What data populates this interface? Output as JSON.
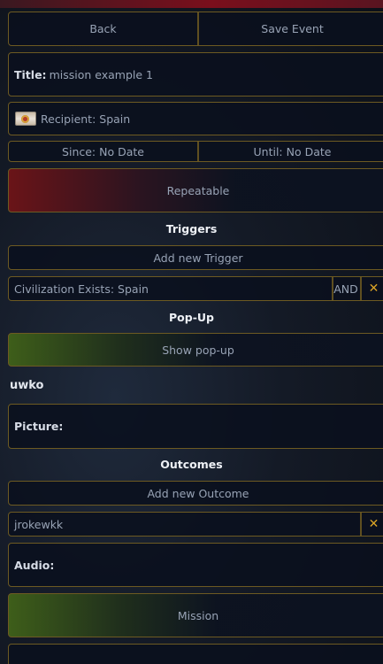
{
  "toolbar": {
    "back_label": "Back",
    "save_label": "Save Event"
  },
  "title": {
    "label": "Title:",
    "value": "mission example 1"
  },
  "recipient": {
    "label": "Recipient: Spain"
  },
  "dates": {
    "since": "Since: No Date",
    "until": "Until: No Date"
  },
  "repeatable": {
    "label": "Repeatable"
  },
  "triggers": {
    "header": "Triggers",
    "add_label": "Add new Trigger",
    "items": [
      {
        "label": "Civilization Exists: Spain",
        "operator": "AND"
      }
    ]
  },
  "popup": {
    "header": "Pop-Up",
    "show_label": "Show pop-up",
    "text": "uwko",
    "picture_label": "Picture:"
  },
  "outcomes": {
    "header": "Outcomes",
    "add_label": "Add new Outcome",
    "items": [
      {
        "label": "jrokewkk"
      }
    ],
    "audio_label": "Audio:",
    "mission_label": "Mission"
  },
  "colors": {
    "border": "#6d5a22",
    "delete": "#d9a326",
    "repeat_red": "#6a1418",
    "popup_green": "#3e5e1a"
  },
  "icons": {
    "delete": "close-icon",
    "flag": "spain-flag-icon"
  }
}
